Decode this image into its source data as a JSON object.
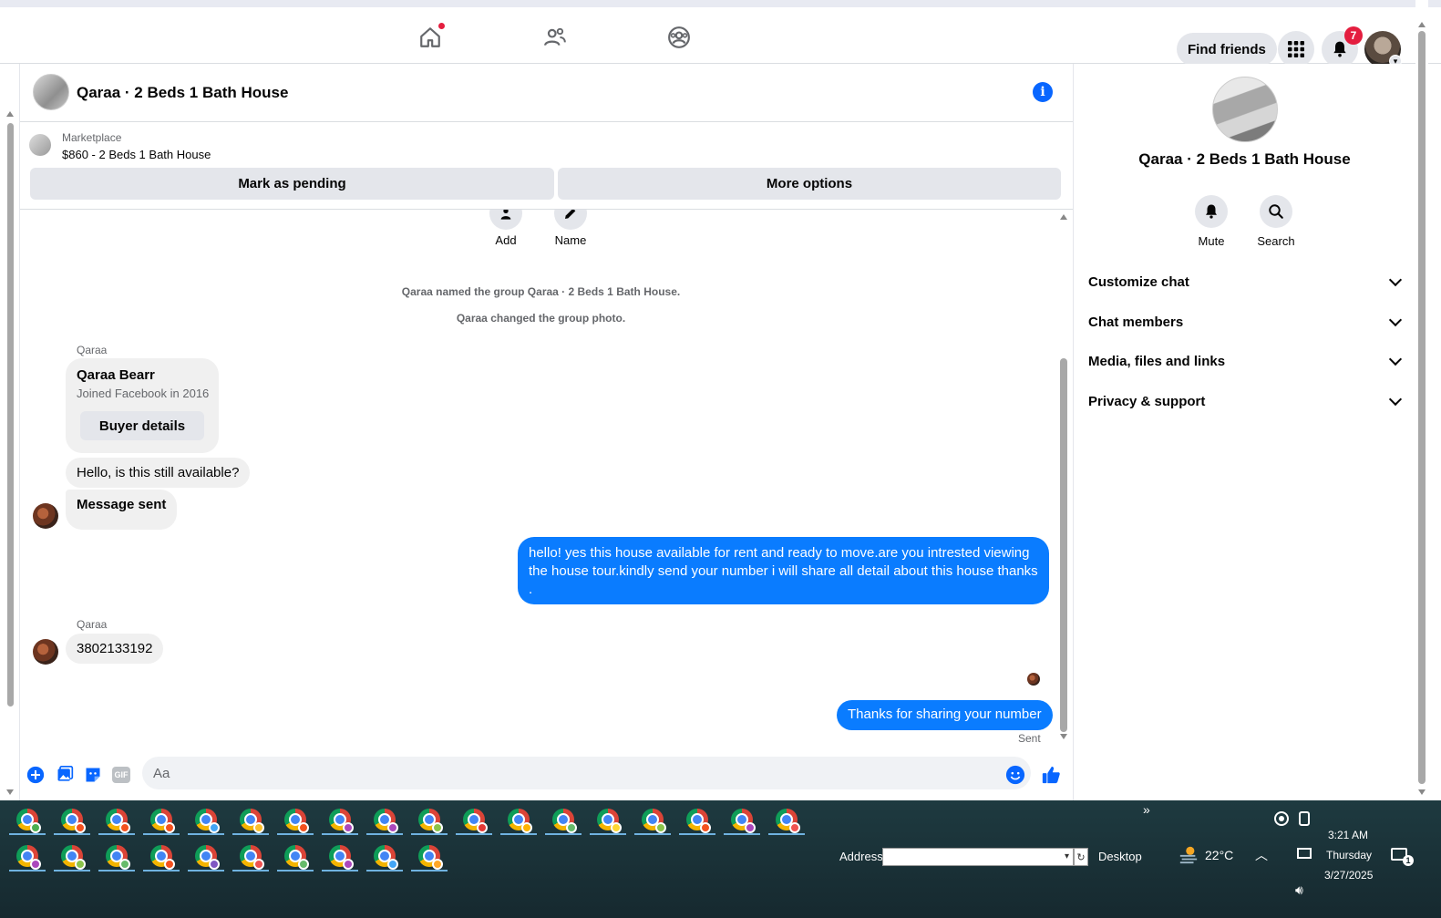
{
  "navbar": {
    "find_friends": "Find friends",
    "notification_count": "7"
  },
  "chat": {
    "title": "Qaraa · 2 Beds 1 Bath House",
    "marketplace": {
      "label": "Marketplace",
      "item": "$860 - 2 Beds 1 Bath House",
      "mark_pending": "Mark as pending",
      "more_options": "More options"
    },
    "quick_actions": [
      {
        "label": "Add"
      },
      {
        "label": "Name"
      }
    ],
    "system_messages": [
      "Qaraa named the group Qaraa · 2 Beds 1 Bath House.",
      "Qaraa changed the group photo."
    ],
    "card": {
      "sender": "Qaraa",
      "name": "Qaraa Bearr",
      "subtitle": "Joined Facebook in 2016",
      "button": "Buyer details"
    },
    "messages": {
      "in_1": "Hello, is this still available?",
      "in_2": "Message sent",
      "out_1": "hello! yes this house available for rent and ready to move.are you intrested viewing the house tour.kindly send your number i will share all detail about this house thanks .",
      "sender_2": "Qaraa",
      "in_3": "3802133192",
      "out_2": "Thanks for sharing your number",
      "status": "Sent"
    },
    "composer_placeholder": "Aa",
    "composer_gif": "GIF"
  },
  "right_panel": {
    "title": "Qaraa · 2 Beds 1 Bath House",
    "actions": [
      {
        "label": "Mute"
      },
      {
        "label": "Search"
      }
    ],
    "sections": [
      "Customize chat",
      "Chat members",
      "Media, files and links",
      "Privacy & support"
    ]
  },
  "taskbar": {
    "address_label": "Address",
    "desktop_label": "Desktop",
    "temperature": "22°C",
    "time": "3:21 AM",
    "day": "Thursday",
    "date": "3/27/2025",
    "notification_count": "1",
    "overflow": "»"
  },
  "colors": {
    "accent": "#0866ff",
    "bubble_out": "#0a7cff",
    "badge": "#e41e3f"
  }
}
